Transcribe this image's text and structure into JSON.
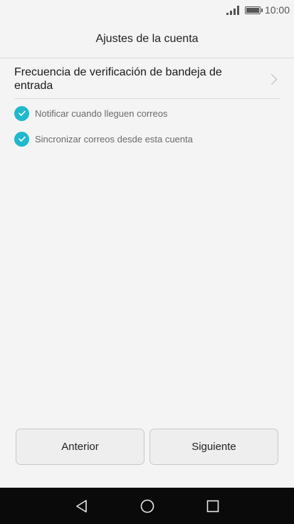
{
  "status_bar": {
    "time": "10:00"
  },
  "header": {
    "title": "Ajustes de la cuenta"
  },
  "settings": {
    "frequency_label": "Frecuencia de verificación de bandeja de entrada",
    "checkboxes": [
      {
        "label": "Notificar cuando lleguen correos",
        "checked": true
      },
      {
        "label": "Sincronizar correos desde esta cuenta",
        "checked": true
      }
    ]
  },
  "buttons": {
    "previous": "Anterior",
    "next": "Siguiente"
  },
  "colors": {
    "accent": "#20b8cc",
    "nav_bar": "#0a0a0a"
  }
}
